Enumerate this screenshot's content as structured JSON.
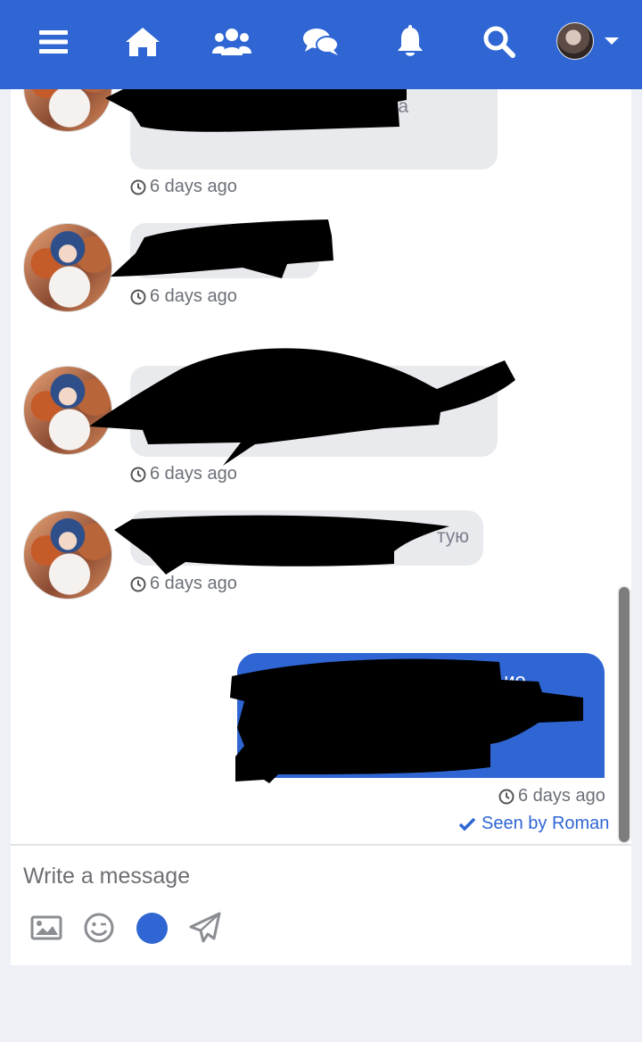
{
  "nav": {
    "items": [
      {
        "name": "menu-icon"
      },
      {
        "name": "home-icon"
      },
      {
        "name": "friends-icon"
      },
      {
        "name": "messages-icon"
      },
      {
        "name": "notifications-icon"
      },
      {
        "name": "search-icon"
      }
    ],
    "accent": "#2f66d4"
  },
  "messages": [
    {
      "direction": "incoming",
      "text": "а",
      "time": "6 days ago"
    },
    {
      "direction": "incoming",
      "text": "",
      "time": "6 days ago"
    },
    {
      "direction": "incoming",
      "text": "",
      "time": "6 days ago"
    },
    {
      "direction": "incoming",
      "text": "тую",
      "time": "6 days ago"
    },
    {
      "direction": "outgoing",
      "text": "ие..",
      "time": "6 days ago",
      "seen": "Seen by Roman"
    }
  ],
  "composer": {
    "placeholder": "Write a message",
    "tools": [
      "image-icon",
      "emoji-icon",
      "record-dot",
      "send-icon"
    ]
  }
}
